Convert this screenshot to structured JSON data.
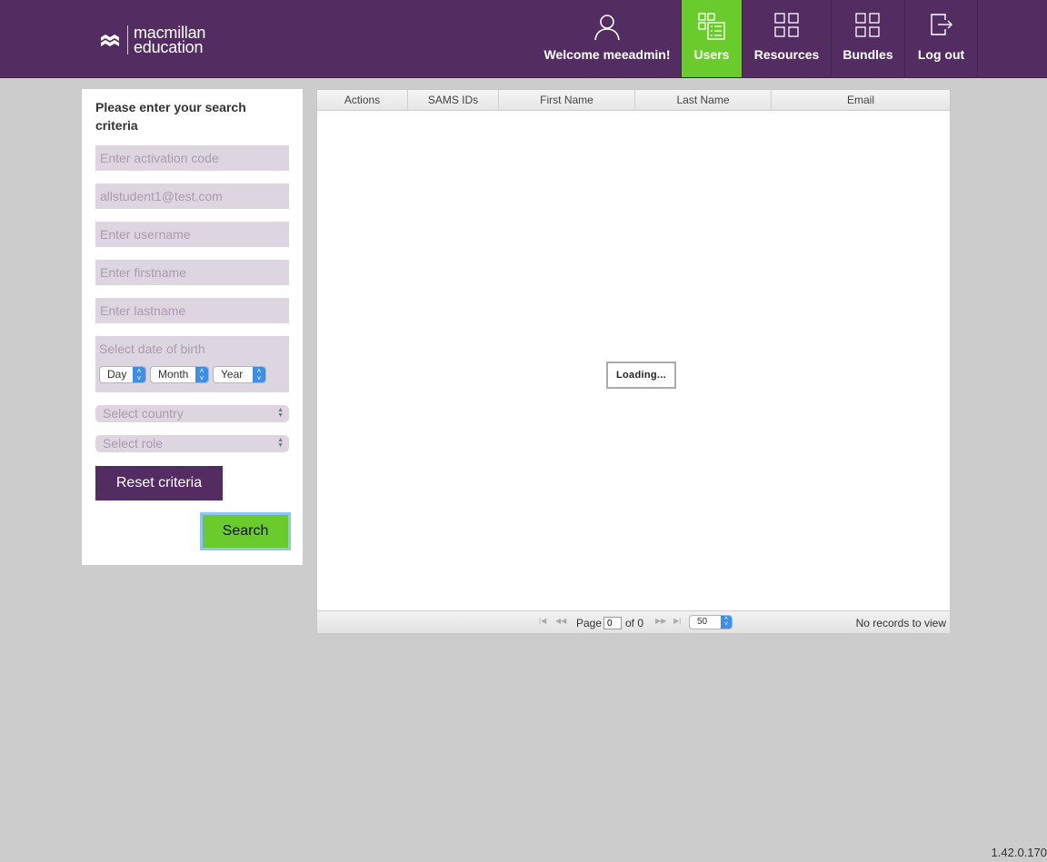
{
  "header": {
    "logo_line1": "macmillan",
    "logo_line2": "education",
    "welcome": "Welcome meeadmin!",
    "nav": {
      "users": "Users",
      "resources": "Resources",
      "bundles": "Bundles",
      "logout": "Log out"
    },
    "active_color": "#6acc2c",
    "brand_color": "#532d62"
  },
  "search": {
    "title": "Please enter your search criteria",
    "activation_placeholder": "Enter activation code",
    "email_placeholder": "allstudent1@test.com",
    "username_placeholder": "Enter username",
    "firstname_placeholder": "Enter firstname",
    "lastname_placeholder": "Enter lastname",
    "dob_label": "Select date of birth",
    "day": "Day",
    "month": "Month",
    "year": "Year",
    "country": "Select country",
    "role": "Select role",
    "reset_label": "Reset criteria",
    "search_label": "Search"
  },
  "grid": {
    "columns": [
      "Actions",
      "SAMS IDs",
      "First Name",
      "Last Name",
      "Email"
    ],
    "loading": "Loading...",
    "pager": {
      "page_label": "Page",
      "page_value": "0",
      "of_label": "of 0",
      "page_size": "50",
      "records": "No records to view"
    }
  },
  "version": "1.42.0.170"
}
